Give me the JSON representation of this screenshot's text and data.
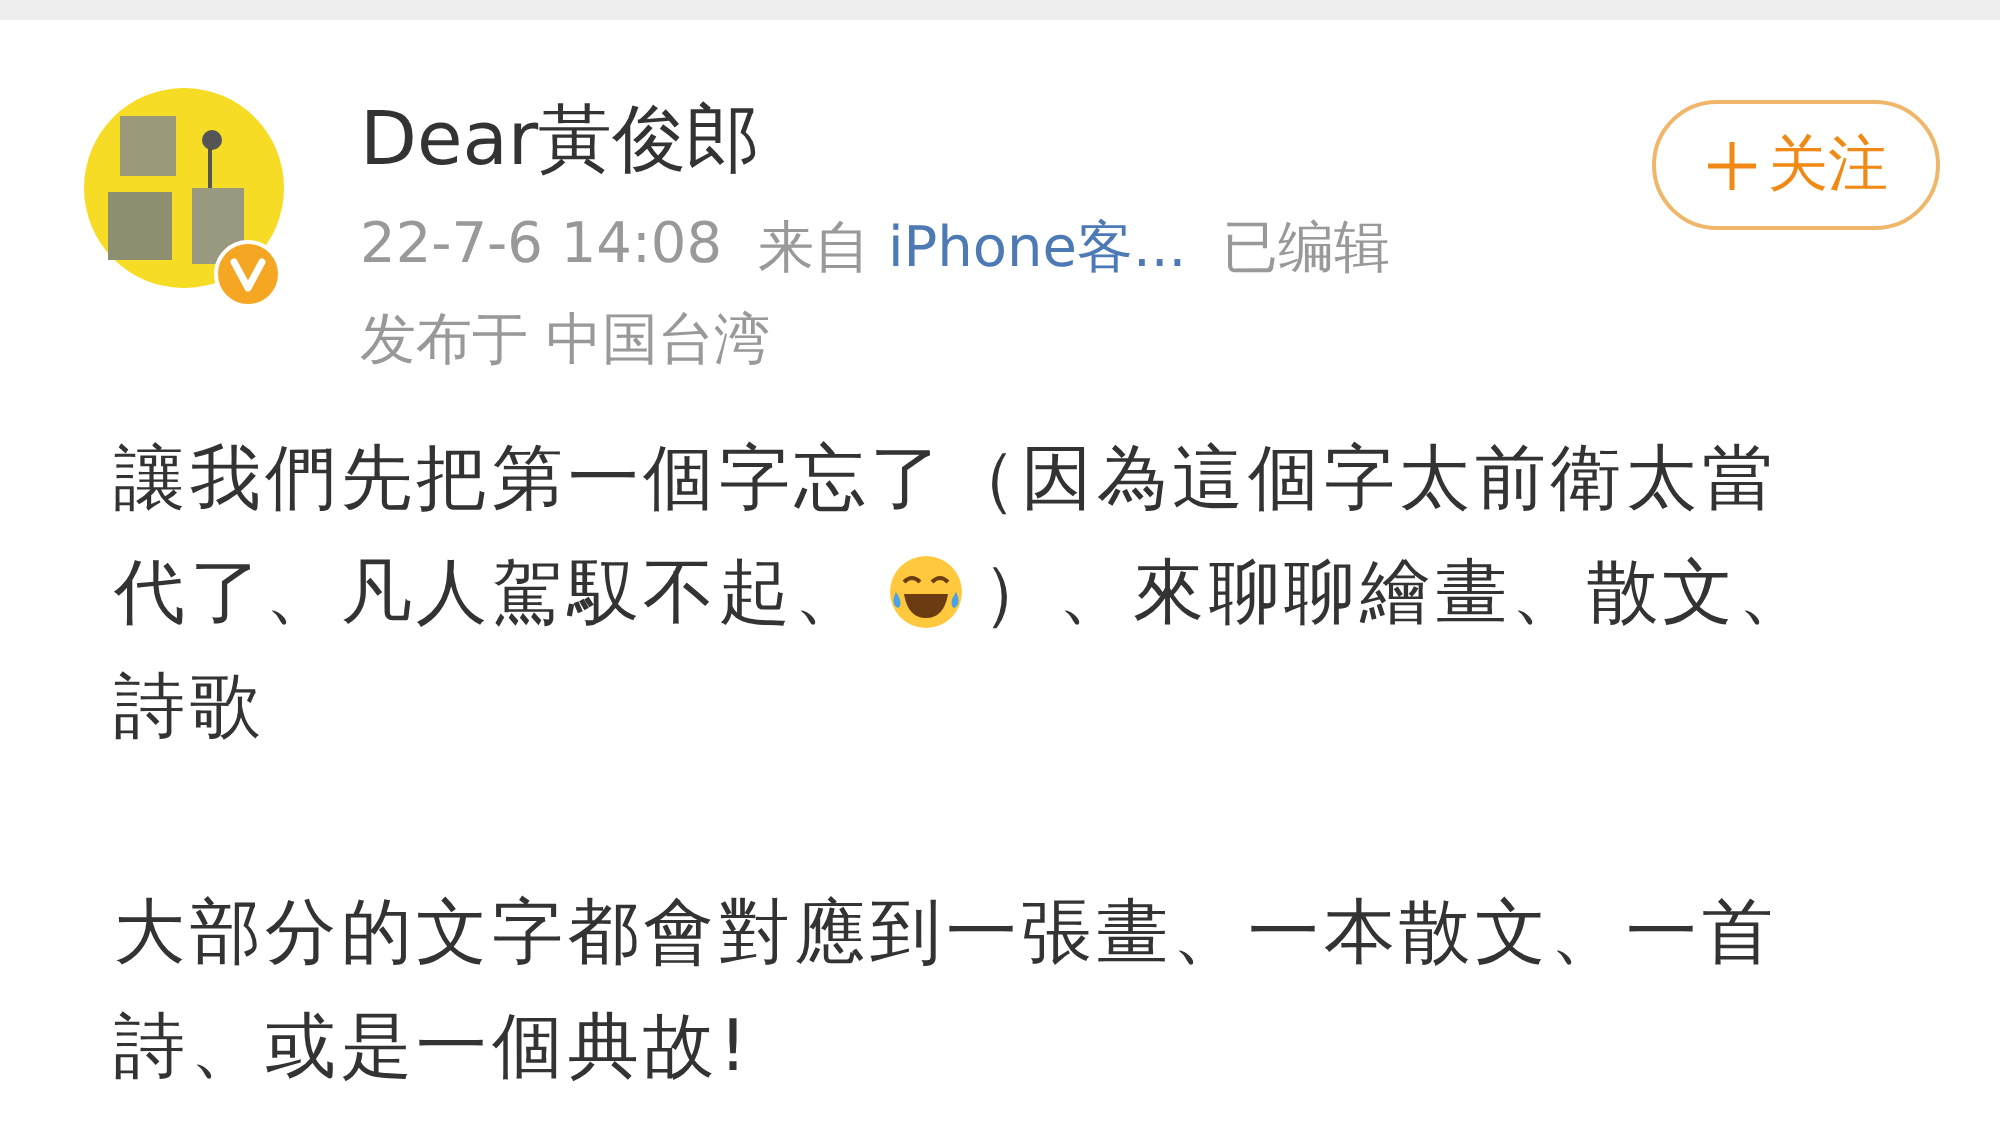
{
  "post": {
    "author": "Dear黃俊郎",
    "verified": true,
    "time": "22-7-6 14:08",
    "source_prefix": "来自",
    "source": "iPhone客...",
    "edited": "已编辑",
    "location": "发布于 中国台湾",
    "follow_label": "关注",
    "paragraphs": [
      [
        [
          {
            "kind": "text",
            "text": "讓我們先把第一個字忘了（因為這個字太前衛太當"
          }
        ],
        [
          {
            "kind": "text",
            "text": "代了、凡人駕馭不起、"
          },
          {
            "kind": "emoji"
          },
          {
            "kind": "text",
            "text": "）、來聊聊繪畫、散文、"
          }
        ],
        [
          {
            "kind": "text",
            "text": "詩歌"
          }
        ]
      ],
      [
        [
          {
            "kind": "text",
            "text": "大部分的文字都會對應到一張畫、一本散文、一首"
          }
        ],
        [
          {
            "kind": "text",
            "text": "詩、或是一個典故!"
          }
        ]
      ]
    ]
  }
}
